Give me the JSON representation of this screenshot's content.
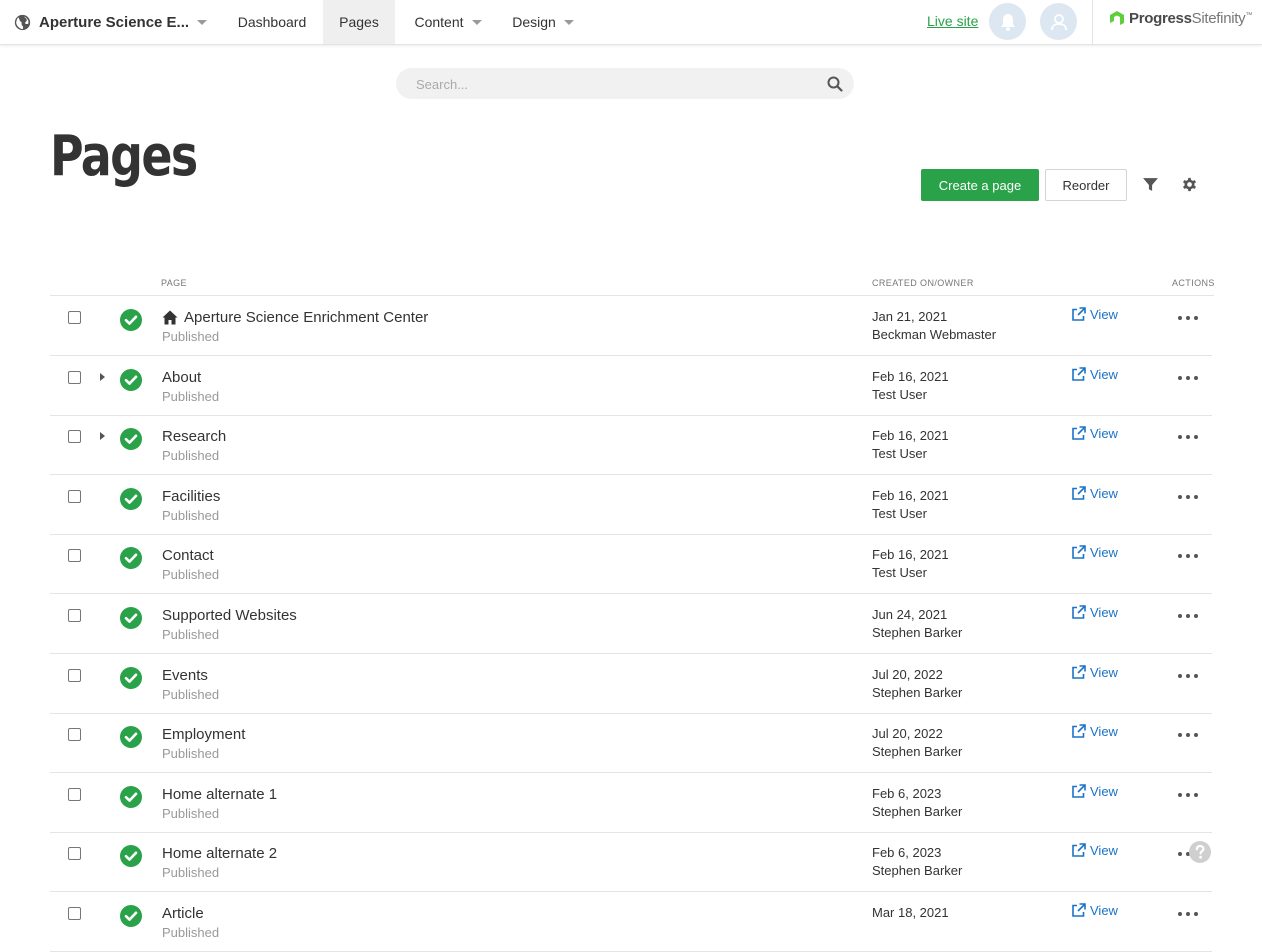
{
  "topbar": {
    "site_name": "Aperture Science E...",
    "nav": [
      {
        "label": "Dashboard",
        "active": false,
        "dropdown": false
      },
      {
        "label": "Pages",
        "active": true,
        "dropdown": false
      },
      {
        "label": "Content",
        "active": false,
        "dropdown": true
      },
      {
        "label": "Design",
        "active": false,
        "dropdown": true
      }
    ],
    "live_site": "Live site",
    "brand_bold": "Progress",
    "brand_light": "Sitefinity",
    "brand_tm": "™"
  },
  "search": {
    "placeholder": "Search..."
  },
  "page": {
    "title": "Pages"
  },
  "toolbar": {
    "create_label": "Create a page",
    "reorder_label": "Reorder"
  },
  "table": {
    "headers": {
      "page": "PAGE",
      "created": "CREATED ON/OWNER",
      "actions": "ACTIONS"
    },
    "view_label": "View",
    "rows": [
      {
        "title": "Aperture Science Enrichment Center",
        "status": "Published",
        "date": "Jan 21, 2021",
        "owner": "Beckman Webmaster",
        "home": true,
        "expandable": false
      },
      {
        "title": "About",
        "status": "Published",
        "date": "Feb 16, 2021",
        "owner": "Test User",
        "home": false,
        "expandable": true
      },
      {
        "title": "Research",
        "status": "Published",
        "date": "Feb 16, 2021",
        "owner": "Test User",
        "home": false,
        "expandable": true
      },
      {
        "title": "Facilities",
        "status": "Published",
        "date": "Feb 16, 2021",
        "owner": "Test User",
        "home": false,
        "expandable": false
      },
      {
        "title": "Contact",
        "status": "Published",
        "date": "Feb 16, 2021",
        "owner": "Test User",
        "home": false,
        "expandable": false
      },
      {
        "title": "Supported Websites",
        "status": "Published",
        "date": "Jun 24, 2021",
        "owner": "Stephen Barker",
        "home": false,
        "expandable": false
      },
      {
        "title": "Events",
        "status": "Published",
        "date": "Jul 20, 2022",
        "owner": "Stephen Barker",
        "home": false,
        "expandable": false
      },
      {
        "title": "Employment",
        "status": "Published",
        "date": "Jul 20, 2022",
        "owner": "Stephen Barker",
        "home": false,
        "expandable": false
      },
      {
        "title": "Home alternate 1",
        "status": "Published",
        "date": "Feb 6, 2023",
        "owner": "Stephen Barker",
        "home": false,
        "expandable": false
      },
      {
        "title": "Home alternate 2",
        "status": "Published",
        "date": "Feb 6, 2023",
        "owner": "Stephen Barker",
        "home": false,
        "expandable": false
      },
      {
        "title": "Article",
        "status": "Published",
        "date": "Mar 18, 2021",
        "owner": "",
        "home": false,
        "expandable": false
      }
    ]
  },
  "colors": {
    "accent_green": "#2aa24a",
    "link_blue": "#1a73c8",
    "avatar_bg": "#dce7f1"
  },
  "icons": [
    "globe-icon",
    "bell-icon",
    "user-icon",
    "search-icon",
    "filter-icon",
    "gear-icon",
    "home-icon",
    "external-link-icon",
    "more-icon",
    "check-circle-icon",
    "help-icon"
  ]
}
